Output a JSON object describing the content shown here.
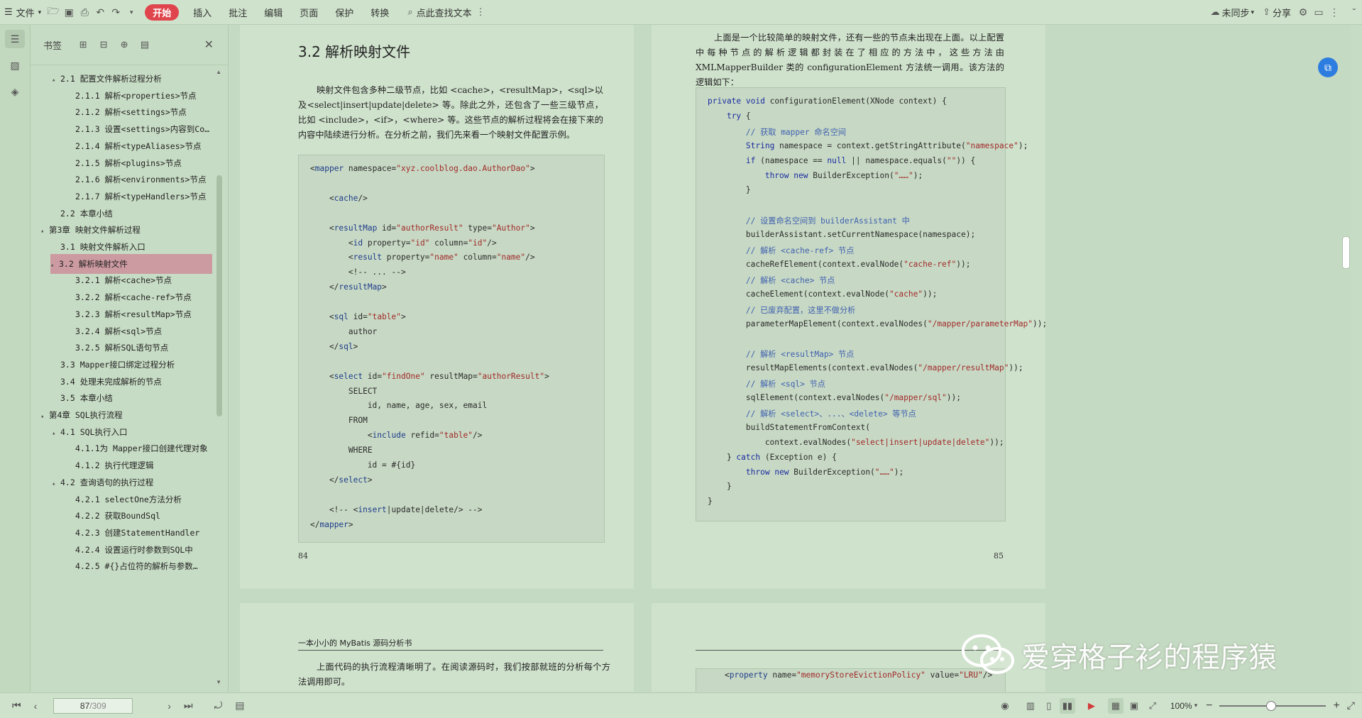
{
  "toolbar": {
    "file_label": "文件",
    "tabs": [
      "开始",
      "插入",
      "批注",
      "编辑",
      "页面",
      "保护",
      "转换"
    ],
    "search_placeholder": "点此查找文本",
    "sync_label": "未同步",
    "share_label": "分享"
  },
  "sidebar": {
    "title": "书签",
    "toc": [
      {
        "level": 1,
        "caret": "▴",
        "label": "2.1 配置文件解析过程分析"
      },
      {
        "level": 2,
        "caret": "",
        "label": "2.1.1 解析<properties>节点"
      },
      {
        "level": 2,
        "caret": "",
        "label": "2.1.2 解析<settings>节点"
      },
      {
        "level": 2,
        "caret": "",
        "label": "2.1.3 设置<settings>内容到Co…"
      },
      {
        "level": 2,
        "caret": "",
        "label": "2.1.4 解析<typeAliases>节点"
      },
      {
        "level": 2,
        "caret": "",
        "label": "2.1.5 解析<plugins>节点"
      },
      {
        "level": 2,
        "caret": "",
        "label": "2.1.6 解析<environments>节点"
      },
      {
        "level": 2,
        "caret": "",
        "label": "2.1.7 解析<typeHandlers>节点"
      },
      {
        "level": 1,
        "caret": "",
        "label": "2.2 本章小结"
      },
      {
        "level": 0,
        "caret": "▴",
        "label": "第3章 映射文件解析过程"
      },
      {
        "level": 1,
        "caret": "",
        "label": "3.1 映射文件解析入口"
      },
      {
        "level": 1,
        "caret": "▴",
        "label": "3.2 解析映射文件",
        "selected": true
      },
      {
        "level": 2,
        "caret": "",
        "label": "3.2.1 解析<cache>节点"
      },
      {
        "level": 2,
        "caret": "",
        "label": "3.2.2 解析<cache-ref>节点"
      },
      {
        "level": 2,
        "caret": "",
        "label": "3.2.3 解析<resultMap>节点"
      },
      {
        "level": 2,
        "caret": "",
        "label": "3.2.4 解析<sql>节点"
      },
      {
        "level": 2,
        "caret": "",
        "label": "3.2.5 解析SQL语句节点"
      },
      {
        "level": 1,
        "caret": "",
        "label": "3.3 Mapper接口绑定过程分析"
      },
      {
        "level": 1,
        "caret": "",
        "label": "3.4 处理未完成解析的节点"
      },
      {
        "level": 1,
        "caret": "",
        "label": "3.5 本章小结"
      },
      {
        "level": 0,
        "caret": "▴",
        "label": "第4章 SQL执行流程"
      },
      {
        "level": 1,
        "caret": "▴",
        "label": "4.1 SQL执行入口"
      },
      {
        "level": 2,
        "caret": "",
        "label": "4.1.1为 Mapper接口创建代理对象"
      },
      {
        "level": 2,
        "caret": "",
        "label": "4.1.2 执行代理逻辑"
      },
      {
        "level": 1,
        "caret": "▴",
        "label": "4.2 查询语句的执行过程"
      },
      {
        "level": 2,
        "caret": "",
        "label": "4.2.1 selectOne方法分析"
      },
      {
        "level": 2,
        "caret": "",
        "label": "4.2.2 获取BoundSql"
      },
      {
        "level": 2,
        "caret": "",
        "label": "4.2.3 创建StatementHandler"
      },
      {
        "level": 2,
        "caret": "",
        "label": "4.2.4 设置运行时参数到SQL中"
      },
      {
        "level": 2,
        "caret": "",
        "label": "4.2.5 #{}占位符的解析与参数…"
      }
    ]
  },
  "doc": {
    "left_page": {
      "heading": "3.2 解析映射文件",
      "paragraph": "映射文件包含多种二级节点，比如 <cache>，<resultMap>，<sql>以及<select|insert|update|delete> 等。除此之外，还包含了一些三级节点，比如 <include>，<if>，<where> 等。这些节点的解析过程将会在接下来的内容中陆续进行分析。在分析之前，我们先来看一个映射文件配置示例。",
      "code": [
        "<mapper namespace=\"xyz.coolblog.dao.AuthorDao\">",
        "",
        "    <cache/>",
        "",
        "    <resultMap id=\"authorResult\" type=\"Author\">",
        "        <id property=\"id\" column=\"id\"/>",
        "        <result property=\"name\" column=\"name\"/>",
        "        <!-- ... -->",
        "    </resultMap>",
        "",
        "    <sql id=\"table\">",
        "        author",
        "    </sql>",
        "",
        "    <select id=\"findOne\" resultMap=\"authorResult\">",
        "        SELECT",
        "            id, name, age, sex, email",
        "        FROM",
        "            <include refid=\"table\"/>",
        "        WHERE",
        "            id = #{id}",
        "    </select>",
        "",
        "    <!-- <insert|update|delete/> -->",
        "</mapper>"
      ],
      "page_number": "84"
    },
    "right_page": {
      "paragraph": "上面是一个比较简单的映射文件，还有一些的节点未出现在上面。以上配置中每种节点的解析逻辑都封装在了相应的方法中，这些方法由 XMLMapperBuilder 类的 configurationElement 方法统一调用。该方法的逻辑如下：",
      "code": [
        "private void configurationElement(XNode context) {",
        "    try {",
        "        // 获取 mapper 命名空间",
        "        String namespace = context.getStringAttribute(\"namespace\");",
        "        if (namespace == null || namespace.equals(\"\")) {",
        "            throw new BuilderException(\"……\");",
        "        }",
        "",
        "        // 设置命名空间到 builderAssistant 中",
        "        builderAssistant.setCurrentNamespace(namespace);",
        "        // 解析 <cache-ref> 节点",
        "        cacheRefElement(context.evalNode(\"cache-ref\"));",
        "        // 解析 <cache> 节点",
        "        cacheElement(context.evalNode(\"cache\"));",
        "        // 已废弃配置，这里不做分析",
        "        parameterMapElement(context.evalNodes(\"/mapper/parameterMap\"));",
        "",
        "        // 解析 <resultMap> 节点",
        "        resultMapElements(context.evalNodes(\"/mapper/resultMap\"));",
        "        // 解析 <sql> 节点",
        "        sqlElement(context.evalNodes(\"/mapper/sql\"));",
        "        // 解析 <select>、...、<delete> 等节点",
        "        buildStatementFromContext(",
        "            context.evalNodes(\"select|insert|update|delete\"));",
        "    } catch (Exception e) {",
        "        throw new BuilderException(\"……\");",
        "    }",
        "}"
      ],
      "page_number": "85"
    },
    "next_page": {
      "header": "一本小小的 MyBatis 源码分析书",
      "paragraph": "上面代码的执行流程清晰明了。在阅读源码时，我们按部就班的分析每个方法调用即可。",
      "right_code_fragment": "<property name=\"memoryStoreEvictionPolicy\" value=\"LRU\"/>"
    }
  },
  "status": {
    "current_page": "87",
    "total_pages": "/309",
    "zoom": "100%"
  },
  "watermark": {
    "text": "爱穿格子衫的程序猿"
  },
  "colors": {
    "accent_red": "#e0454d",
    "eye_care_green": "#c7dcc4",
    "selected_bookmark": "#cc9aa1"
  }
}
